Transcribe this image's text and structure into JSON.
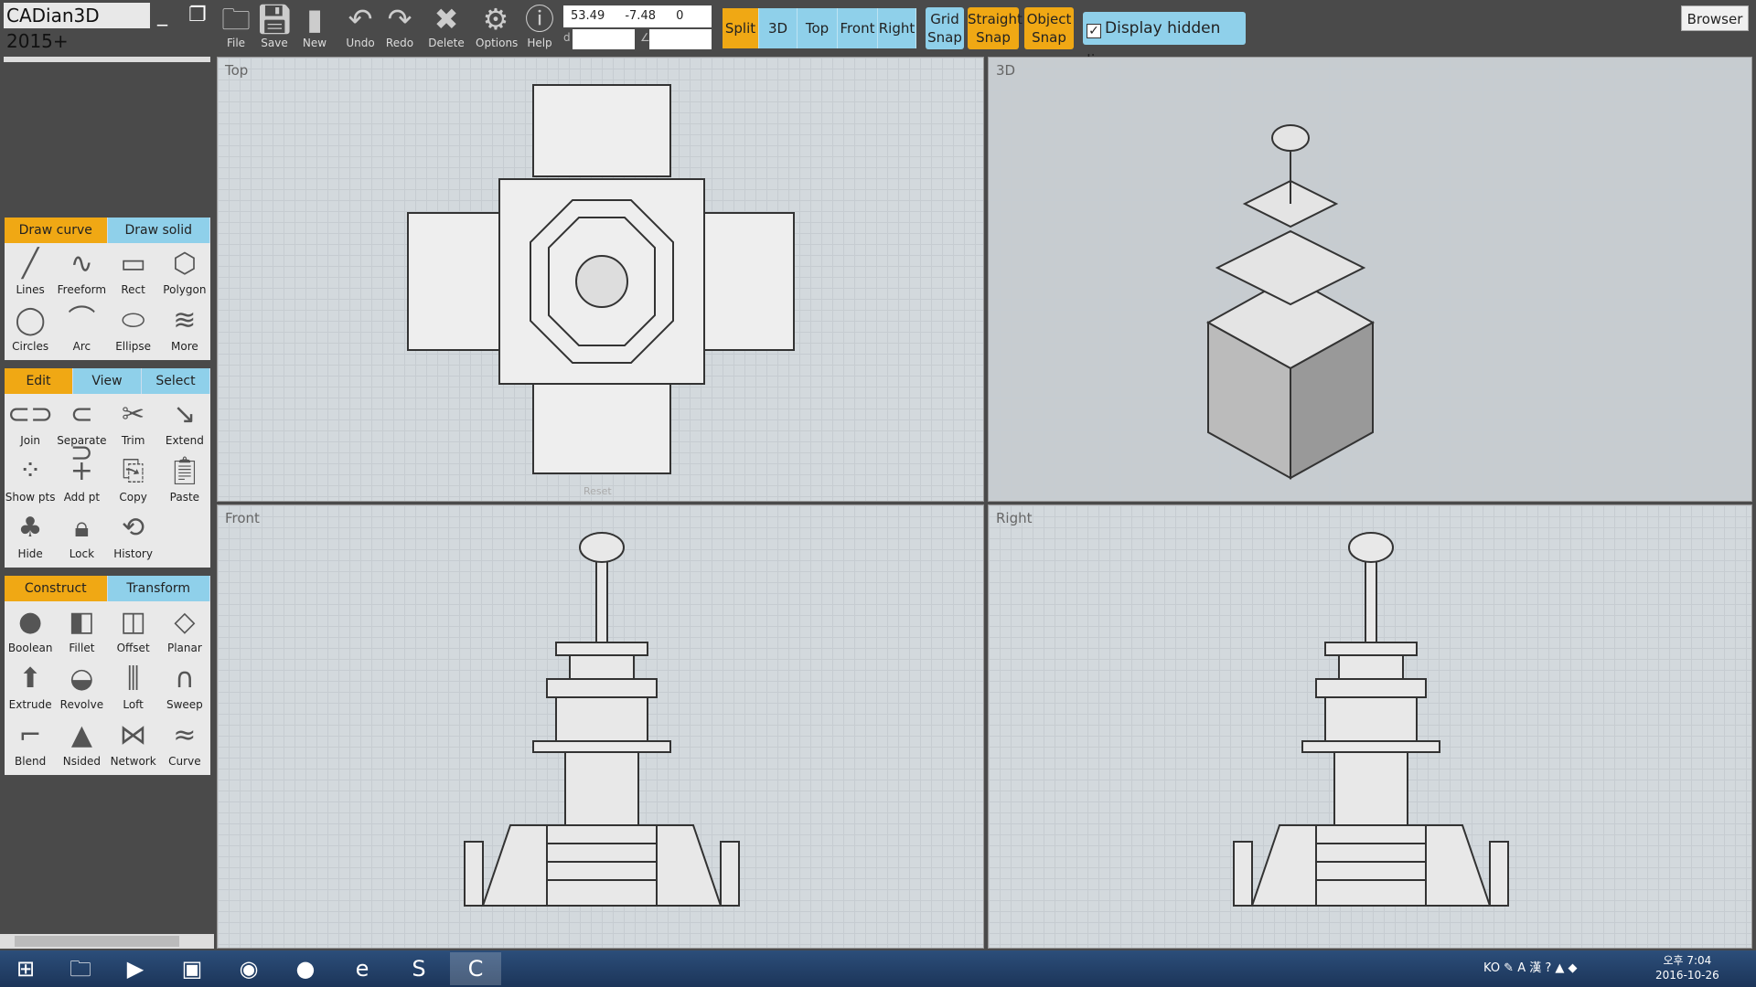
{
  "app": {
    "title": "CADian3D 2015+"
  },
  "toolbar": {
    "tools": [
      {
        "label": "File",
        "icon": "folder-icon"
      },
      {
        "label": "Save",
        "icon": "floppy-icon"
      },
      {
        "label": "New",
        "icon": "new-doc-icon"
      },
      {
        "label": "Undo",
        "icon": "undo-icon"
      },
      {
        "label": "Redo",
        "icon": "redo-icon"
      },
      {
        "label": "Delete",
        "icon": "x-icon"
      },
      {
        "label": "Options",
        "icon": "gear-icon"
      },
      {
        "label": "Help",
        "icon": "help-icon"
      }
    ],
    "coords": "53.49 -7.48 0",
    "distance_label": "d",
    "angle_label": "∠",
    "views": [
      {
        "label": "Split",
        "active": true
      },
      {
        "label": "3D"
      },
      {
        "label": "Top"
      },
      {
        "label": "Front"
      },
      {
        "label": "Right"
      }
    ],
    "snaps": [
      {
        "l1": "Grid",
        "l2": "Snap",
        "active": false
      },
      {
        "l1": "Straight",
        "l2": "Snap",
        "active": true
      },
      {
        "l1": "Object",
        "l2": "Snap",
        "active": true
      }
    ],
    "display_hidden_lines": {
      "label": "Display hidden lines",
      "checked": true
    },
    "browser": "Browser"
  },
  "panels": {
    "draw": {
      "tabs": [
        "Draw curve",
        "Draw solid"
      ],
      "items": [
        "Lines",
        "Freeform",
        "Rect",
        "Polygon",
        "Circles",
        "Arc",
        "Ellipse",
        "More"
      ]
    },
    "edit": {
      "tabs": [
        "Edit",
        "View",
        "Select"
      ],
      "items": [
        "Join",
        "Separate",
        "Trim",
        "Extend",
        "Show pts",
        "Add pt",
        "Copy",
        "Paste",
        "Hide",
        "Lock",
        "History"
      ]
    },
    "construct": {
      "tabs": [
        "Construct",
        "Transform"
      ],
      "items": [
        "Boolean",
        "Fillet",
        "Offset",
        "Planar",
        "Extrude",
        "Revolve",
        "Loft",
        "Sweep",
        "Blend",
        "Nsided",
        "Network",
        "Curve"
      ]
    }
  },
  "viewports": {
    "top": "Top",
    "3d": "3D",
    "front": "Front",
    "right": "Right",
    "reset": "Reset"
  },
  "tray": {
    "lang": "KO",
    "time": "오후 7:04",
    "date": "2016-10-26"
  },
  "colors": {
    "accent": "#f0a814",
    "tab": "#8fd0ea"
  }
}
